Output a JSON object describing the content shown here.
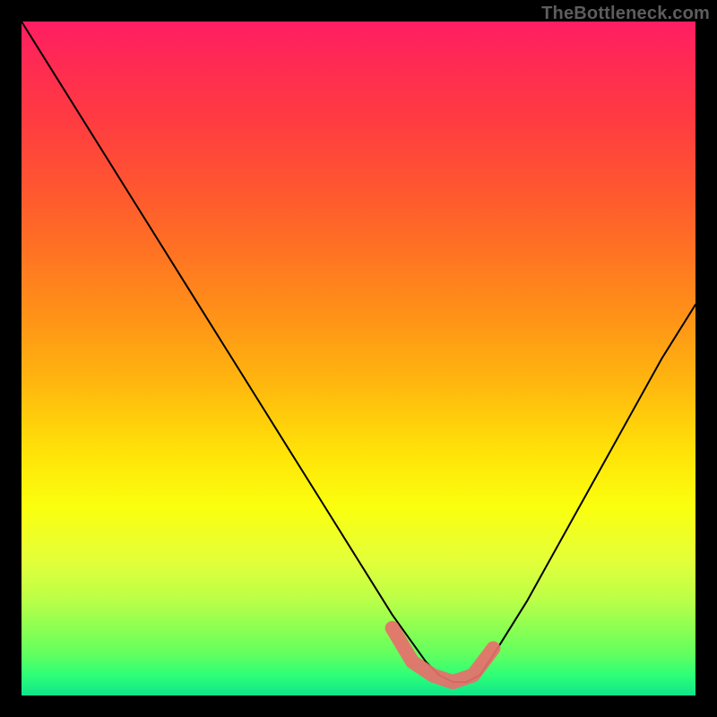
{
  "watermark": {
    "text": "TheBottleneck.com"
  },
  "chart_data": {
    "type": "line",
    "title": "",
    "xlabel": "",
    "ylabel": "",
    "xlim": [
      0,
      100
    ],
    "ylim": [
      0,
      100
    ],
    "grid": false,
    "legend": false,
    "description": "V-shaped bottleneck curve over a red→yellow→green vertical gradient; minimum (best match) highlighted in salmon.",
    "series": [
      {
        "name": "bottleneck-curve",
        "x": [
          0,
          5,
          10,
          15,
          20,
          25,
          30,
          35,
          40,
          45,
          50,
          55,
          60,
          62,
          64,
          66,
          68,
          70,
          75,
          80,
          85,
          90,
          95,
          100
        ],
        "values": [
          100,
          92,
          84,
          76,
          68,
          60,
          52,
          44,
          36,
          28,
          20,
          12,
          5,
          3,
          2,
          2,
          3,
          6,
          14,
          23,
          32,
          41,
          50,
          58
        ]
      }
    ],
    "highlight": {
      "name": "optimal-range-marker",
      "color": "#e86f6d",
      "x": [
        55,
        58,
        61,
        64,
        67,
        70
      ],
      "values": [
        10,
        5,
        3,
        2,
        3,
        7
      ]
    },
    "gradient_stops": [
      {
        "pos": 0.0,
        "color": "#ff1e63"
      },
      {
        "pos": 0.34,
        "color": "#ff7223"
      },
      {
        "pos": 0.64,
        "color": "#ffe308"
      },
      {
        "pos": 0.86,
        "color": "#b9ff48"
      },
      {
        "pos": 1.0,
        "color": "#10e58a"
      }
    ]
  }
}
